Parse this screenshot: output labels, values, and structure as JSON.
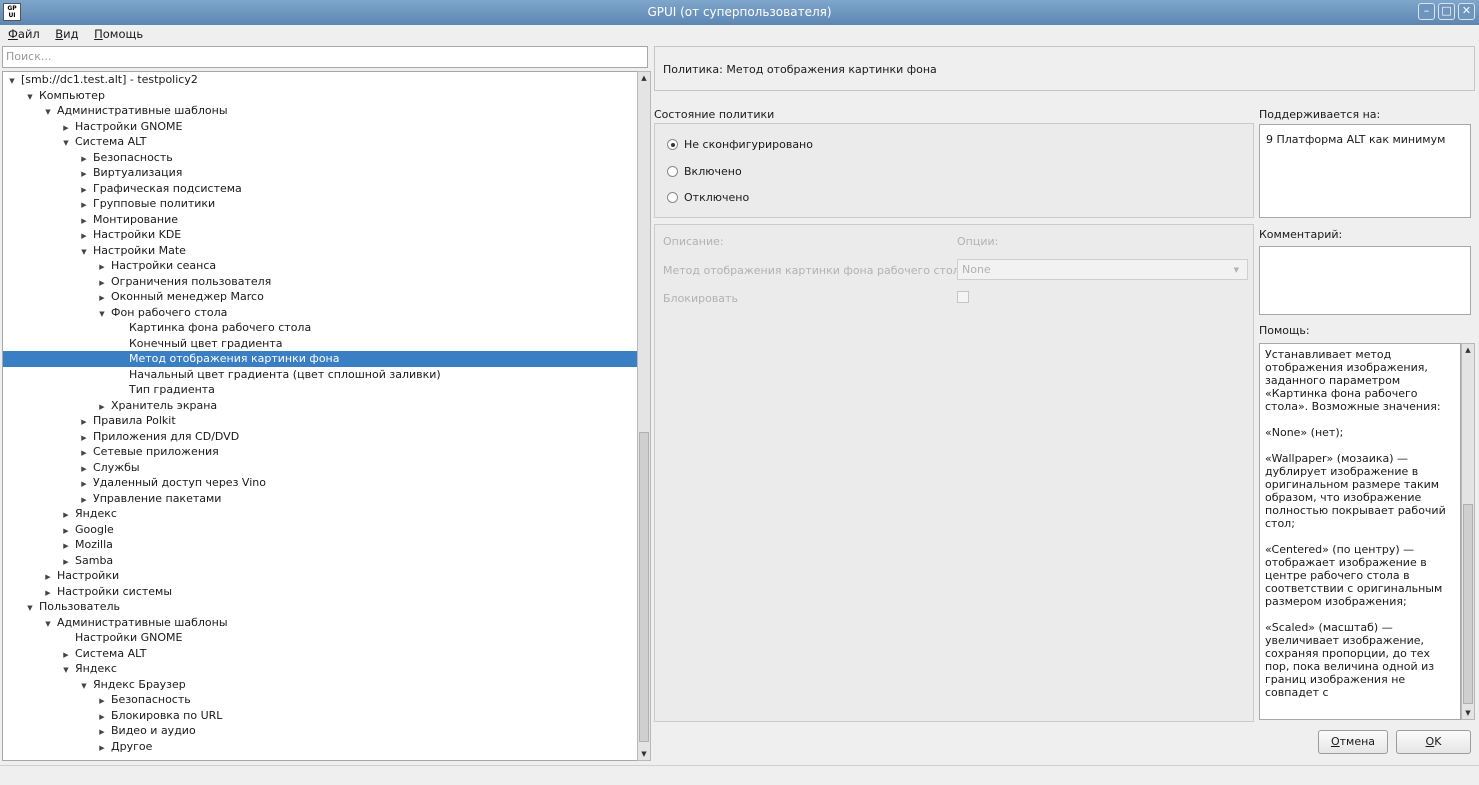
{
  "window": {
    "title": "GPUI (от суперпользователя)",
    "icon_text": "GP\nUI",
    "controls": [
      "–",
      "□",
      "✕"
    ]
  },
  "menu": [
    {
      "underline": "Ф",
      "rest": "айл"
    },
    {
      "underline": "В",
      "rest": "ид"
    },
    {
      "underline": "П",
      "rest": "омощь"
    }
  ],
  "search": {
    "placeholder": "Поиск..."
  },
  "tree": [
    {
      "label": "[smb://dc1.test.alt] - testpolicy2",
      "level": 0,
      "arrow": "down"
    },
    {
      "label": "Компьютер",
      "level": 1,
      "arrow": "down"
    },
    {
      "label": "Административные шаблоны",
      "level": 2,
      "arrow": "down"
    },
    {
      "label": "Настройки GNOME",
      "level": 3,
      "arrow": "right"
    },
    {
      "label": "Система ALT",
      "level": 3,
      "arrow": "down"
    },
    {
      "label": "Безопасность",
      "level": 4,
      "arrow": "right"
    },
    {
      "label": "Виртуализация",
      "level": 4,
      "arrow": "right"
    },
    {
      "label": "Графическая подсистема",
      "level": 4,
      "arrow": "right"
    },
    {
      "label": "Групповые политики",
      "level": 4,
      "arrow": "right"
    },
    {
      "label": "Монтирование",
      "level": 4,
      "arrow": "right"
    },
    {
      "label": "Настройки KDE",
      "level": 4,
      "arrow": "right"
    },
    {
      "label": "Настройки Mate",
      "level": 4,
      "arrow": "down"
    },
    {
      "label": "Настройки сеанса",
      "level": 5,
      "arrow": "right"
    },
    {
      "label": "Ограничения пользователя",
      "level": 5,
      "arrow": "right"
    },
    {
      "label": "Оконный менеджер Marco",
      "level": 5,
      "arrow": "right"
    },
    {
      "label": "Фон рабочего стола",
      "level": 5,
      "arrow": "down"
    },
    {
      "label": "Картинка фона рабочего стола",
      "level": 6,
      "arrow": "none"
    },
    {
      "label": "Конечный цвет градиента",
      "level": 6,
      "arrow": "none"
    },
    {
      "label": "Метод отображения картинки фона",
      "level": 6,
      "arrow": "none",
      "selected": true
    },
    {
      "label": "Начальный цвет градиента (цвет сплошной заливки)",
      "level": 6,
      "arrow": "none"
    },
    {
      "label": "Тип градиента",
      "level": 6,
      "arrow": "none"
    },
    {
      "label": "Хранитель экрана",
      "level": 5,
      "arrow": "right"
    },
    {
      "label": "Правила Polkit",
      "level": 4,
      "arrow": "right"
    },
    {
      "label": "Приложения для CD/DVD",
      "level": 4,
      "arrow": "right"
    },
    {
      "label": "Сетевые приложения",
      "level": 4,
      "arrow": "right"
    },
    {
      "label": "Службы",
      "level": 4,
      "arrow": "right"
    },
    {
      "label": "Удаленный доступ через Vino",
      "level": 4,
      "arrow": "right"
    },
    {
      "label": "Управление пакетами",
      "level": 4,
      "arrow": "right"
    },
    {
      "label": "Яндекс",
      "level": 3,
      "arrow": "right"
    },
    {
      "label": "Google",
      "level": 3,
      "arrow": "right"
    },
    {
      "label": "Mozilla",
      "level": 3,
      "arrow": "right"
    },
    {
      "label": "Samba",
      "level": 3,
      "arrow": "right"
    },
    {
      "label": "Настройки",
      "level": 2,
      "arrow": "right"
    },
    {
      "label": "Настройки системы",
      "level": 2,
      "arrow": "right"
    },
    {
      "label": "Пользователь",
      "level": 1,
      "arrow": "down"
    },
    {
      "label": "Административные шаблоны",
      "level": 2,
      "arrow": "down"
    },
    {
      "label": "Настройки GNOME",
      "level": 3,
      "arrow": "none"
    },
    {
      "label": "Система ALT",
      "level": 3,
      "arrow": "right"
    },
    {
      "label": "Яндекс",
      "level": 3,
      "arrow": "down"
    },
    {
      "label": "Яндекс Браузер",
      "level": 4,
      "arrow": "down"
    },
    {
      "label": "Безопасность",
      "level": 5,
      "arrow": "right"
    },
    {
      "label": "Блокировка по URL",
      "level": 5,
      "arrow": "right"
    },
    {
      "label": "Видео и аудио",
      "level": 5,
      "arrow": "right"
    },
    {
      "label": "Другое",
      "level": 5,
      "arrow": "right"
    }
  ],
  "policy": {
    "header": "Политика: Метод отображения картинки фона",
    "state_label": "Состояние политики",
    "radios": [
      {
        "label": "Не сконфигурировано",
        "checked": true
      },
      {
        "label": "Включено",
        "checked": false
      },
      {
        "label": "Отключено",
        "checked": false
      }
    ],
    "description_label": "Описание:",
    "options_label": "Опции:",
    "option_name": "Метод отображения картинки фона рабочего стола:",
    "option_value": "None",
    "lock_label": "Блокировать"
  },
  "supported": {
    "label": "Поддерживается на:",
    "value": "9 Платформа ALT как минимум"
  },
  "comment": {
    "label": "Комментарий:",
    "value": ""
  },
  "help": {
    "label": "Помощь:",
    "paragraphs": [
      "Устанавливает метод отображения изображения, заданного параметром «Картинка фона рабочего стола». Возможные значения:",
      "«None» (нет);",
      "«Wallpaper» (мозаика) — дублирует изображение в оригинальном размере таким образом, что изображение полностью покрывает рабочий стол;",
      "«Centered» (по центру) — отображает изображение в центре рабочего стола в соответствии с оригинальным размером изображения;",
      "«Scaled» (масштаб) — увеличивает изображение, сохраняя пропорции, до тех пор, пока величина одной из границ изображения не совпадет с"
    ]
  },
  "buttons": {
    "cancel_u": "О",
    "cancel_rest": "тмена",
    "ok_u": "O",
    "ok_rest": "K"
  },
  "colors": {
    "selection": "#3a7fc4",
    "titlebar": "#5c86b3"
  }
}
